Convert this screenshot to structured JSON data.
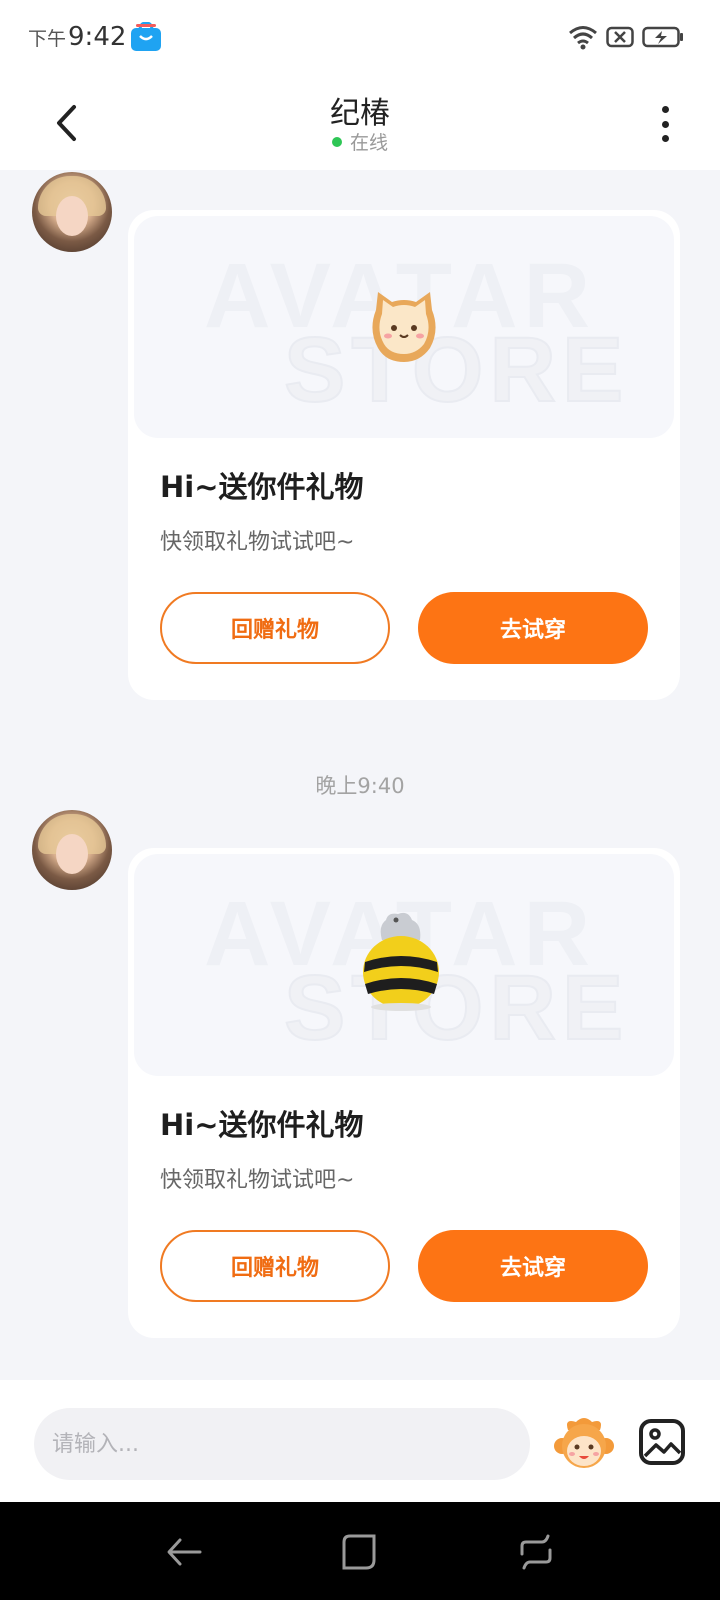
{
  "status_bar": {
    "ampm": "下午",
    "time": "9:42",
    "app_icon": "shopping-bag-icon",
    "icons": [
      "wifi-icon",
      "no-sim-icon",
      "battery-charging-icon"
    ]
  },
  "header": {
    "title": "纪椿",
    "status": "在线",
    "status_color": "#2ec655",
    "back_icon": "back-arrow-icon",
    "more_icon": "more-vertical-icon"
  },
  "messages": [
    {
      "sticker": "cat-toast-icon",
      "watermark_top": "AVATAR",
      "watermark_bottom": "STORE",
      "title": "Hi~送你件礼物",
      "subtitle": "快领取礼物试试吧~",
      "secondary_button": "回赠礼物",
      "primary_button": "去试穿"
    },
    {
      "sticker": "bee-costume-icon",
      "watermark_top": "AVATAR",
      "watermark_bottom": "STORE",
      "title": "Hi~送你件礼物",
      "subtitle": "快领取礼物试试吧~",
      "secondary_button": "回赠礼物",
      "primary_button": "去试穿"
    }
  ],
  "timestamp": "晚上9:40",
  "input_bar": {
    "placeholder": "请输入...",
    "emoji_icon": "monkey-emoji-icon",
    "image_icon": "image-icon"
  },
  "nav_bar": {
    "icons": [
      "back-nav-icon",
      "home-nav-icon",
      "recents-nav-icon"
    ]
  },
  "colors": {
    "accent": "#fd7414",
    "background": "#f4f5f9"
  }
}
